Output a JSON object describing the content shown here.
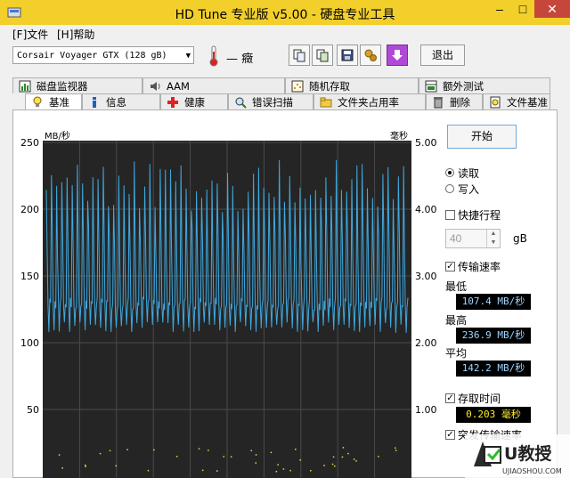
{
  "window": {
    "title": "HD Tune 专业版 v5.00 - 硬盘专业工具",
    "min_label": "–",
    "max_label": "□",
    "close_label": "✕"
  },
  "menu": {
    "file": "[F]文件",
    "help": "[H]帮助"
  },
  "toolbar": {
    "drive": "Corsair Voyager GTX      (128 gB)",
    "temperature": "— 癥",
    "exit_label": "退出"
  },
  "tabs_top": [
    "磁盘监视器",
    "AAM",
    "随机存取",
    "额外测试"
  ],
  "tabs_bottom": [
    "基准",
    "信息",
    "健康",
    "错误扫描",
    "文件夹占用率",
    "删除",
    "文件基准"
  ],
  "chart_data": {
    "type": "line",
    "ylabel_left": "MB/秒",
    "ylabel_right": "毫秒",
    "left_ticks": [
      "250",
      "200",
      "150",
      "100",
      "50"
    ],
    "right_ticks": [
      "5.00",
      "4.00",
      "3.00",
      "2.00",
      "1.00"
    ],
    "ylim_left": [
      0,
      250
    ],
    "ylim_right": [
      0,
      5
    ],
    "transfer_min": 107.4,
    "transfer_max": 236.9,
    "transfer_avg": 142.2,
    "access_time_ms": 0.203,
    "series_color": "#3fa9e0",
    "grid": true
  },
  "side": {
    "start_label": "开始",
    "read_label": "读取",
    "write_label": "写入",
    "quick_label": "快捷行程",
    "quick_value": "40",
    "quick_unit": "gB",
    "transfer_label": "传输速率",
    "min_label": "最低",
    "min_value": "107.4 MB/秒",
    "max_label": "最高",
    "max_value": "236.9 MB/秒",
    "avg_label": "平均",
    "avg_value": "142.2 MB/秒",
    "access_label": "存取时间",
    "access_value": "0.203 毫秒",
    "burst_label": "突发传输速率"
  },
  "watermark": {
    "text": "U教授",
    "url": "UJIAOSHOU.COM"
  }
}
